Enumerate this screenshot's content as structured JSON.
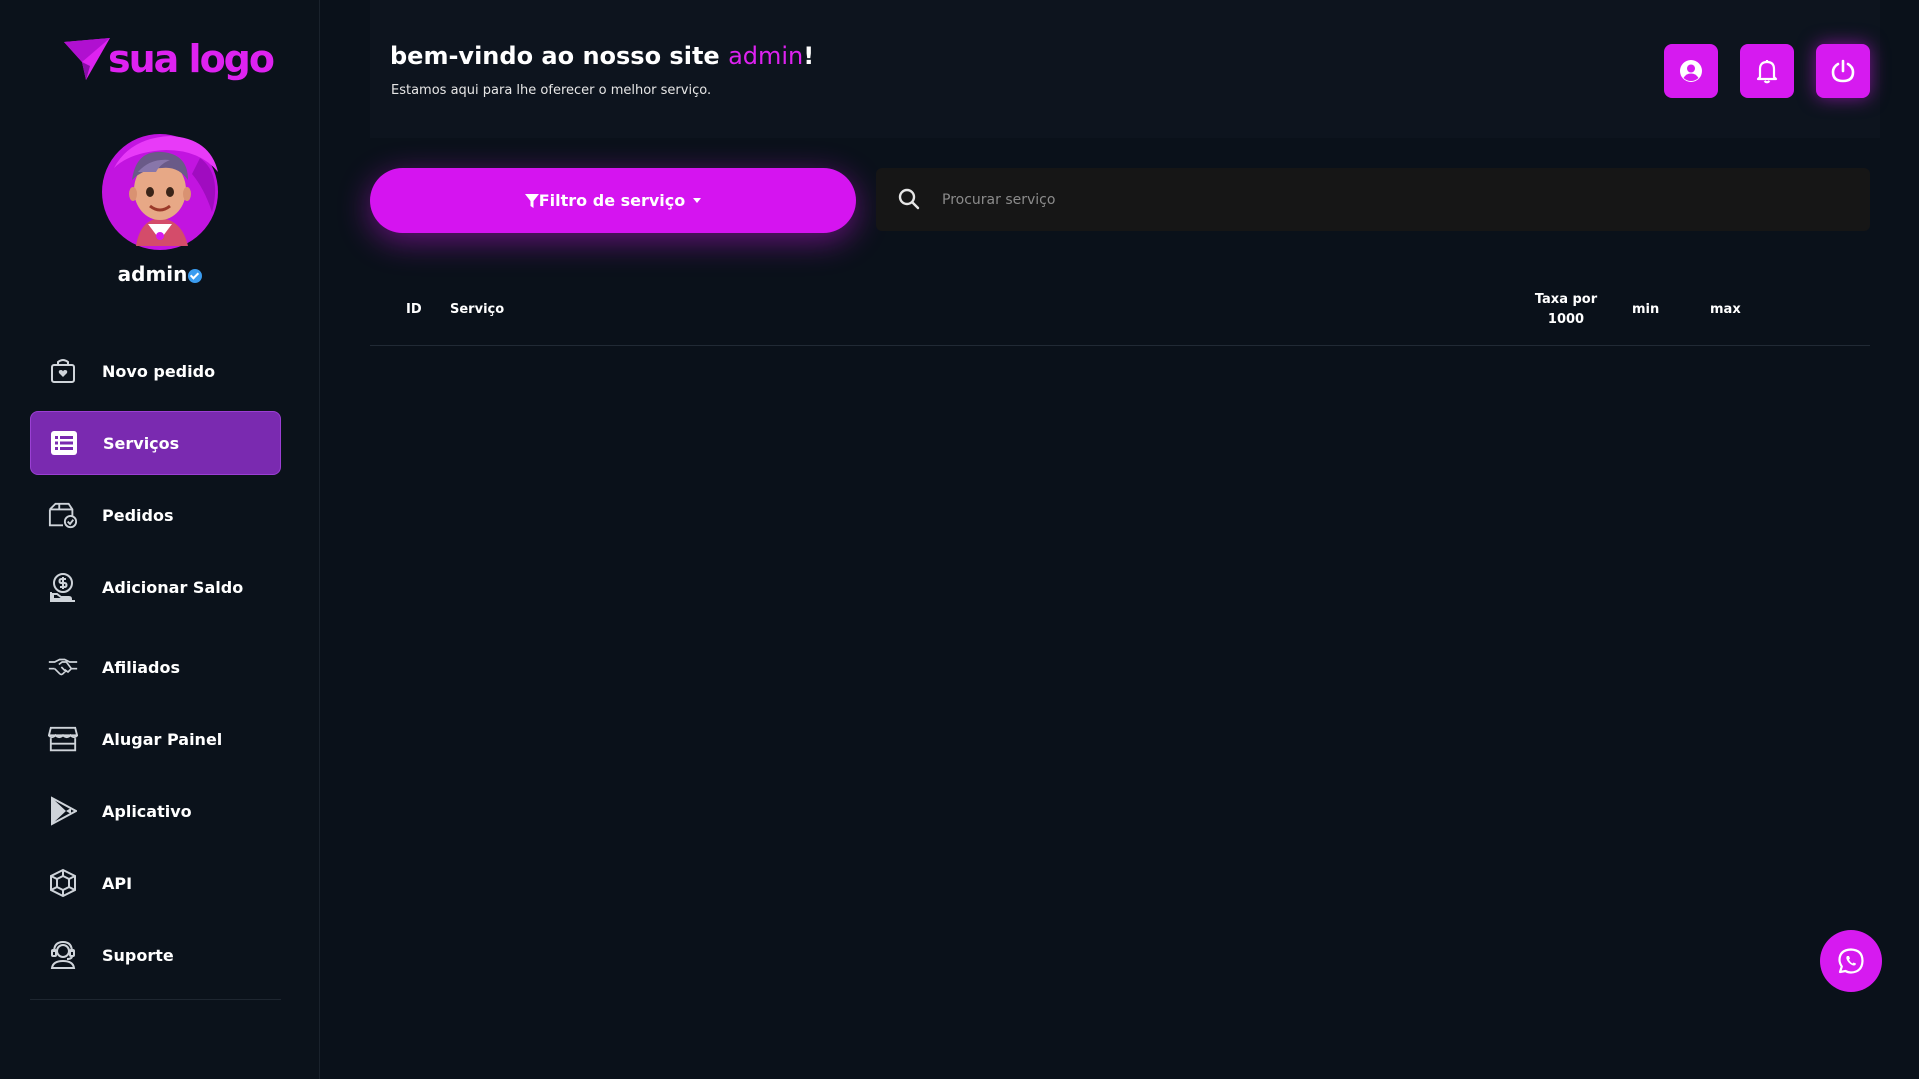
{
  "brand": {
    "logo_text": "sua logo",
    "accent": "#d61af0"
  },
  "user": {
    "name": "admin"
  },
  "header": {
    "welcome_prefix": "bem-vindo ao nosso site ",
    "welcome_name": "admin",
    "welcome_suffix": "!",
    "subtitle": "Estamos aqui para lhe oferecer o melhor serviço."
  },
  "top_buttons": [
    {
      "icon": "user-circle-icon"
    },
    {
      "icon": "bell-icon"
    },
    {
      "icon": "power-icon"
    }
  ],
  "sidebar": {
    "items": [
      {
        "label": "Novo pedido",
        "icon": "shopping-bag-heart-icon",
        "active": false
      },
      {
        "label": "Serviços",
        "icon": "list-icon",
        "active": true
      },
      {
        "label": "Pedidos",
        "icon": "package-check-icon",
        "active": false
      },
      {
        "label": "Adicionar Saldo",
        "icon": "money-hand-icon",
        "active": false
      },
      {
        "label": "Afiliados",
        "icon": "handshake-icon",
        "active": false
      },
      {
        "label": "Alugar Painel",
        "icon": "store-icon",
        "active": false
      },
      {
        "label": "Aplicativo",
        "icon": "play-store-icon",
        "active": false
      },
      {
        "label": "API",
        "icon": "api-cube-icon",
        "active": false
      },
      {
        "label": "Suporte",
        "icon": "support-agent-icon",
        "active": false
      }
    ]
  },
  "filter": {
    "label": "Filtro de serviço"
  },
  "search": {
    "placeholder": "Procurar serviço"
  },
  "table": {
    "columns": [
      "ID",
      "Serviço",
      "Taxa por 1000",
      "min",
      "max"
    ],
    "col_rate_line1": "Taxa por",
    "col_rate_line2": "1000",
    "rows": []
  },
  "floating": {
    "icon": "whatsapp-icon"
  }
}
